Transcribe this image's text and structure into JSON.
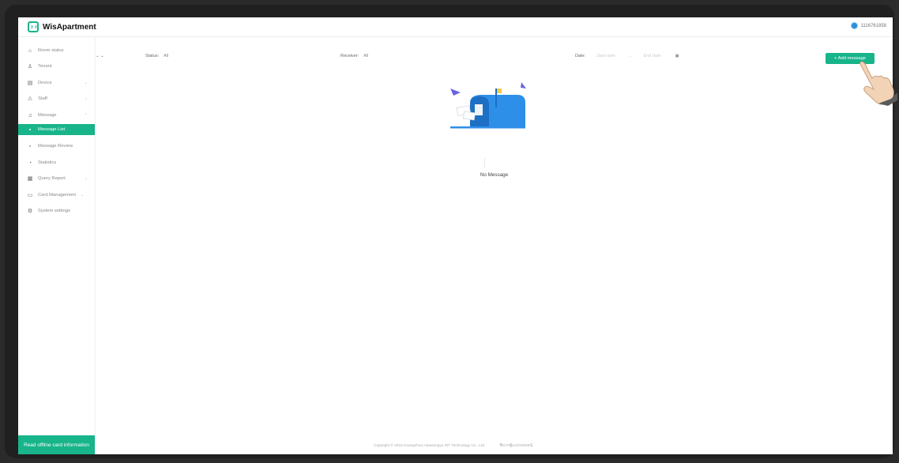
{
  "app": {
    "name": "WisApartment"
  },
  "user": {
    "id": "1116761858"
  },
  "sidebar": {
    "items": [
      {
        "label": "Room status",
        "icon": "home-icon",
        "chevron": false,
        "sub": false,
        "active": false
      },
      {
        "label": "Tenant",
        "icon": "person-icon",
        "chevron": false,
        "sub": false,
        "active": false
      },
      {
        "label": "Device",
        "icon": "device-icon",
        "chevron": true,
        "sub": false,
        "active": false
      },
      {
        "label": "Staff",
        "icon": "staff-icon",
        "chevron": true,
        "sub": false,
        "active": false
      },
      {
        "label": "Message",
        "icon": "bell-icon",
        "chevron": true,
        "sub": false,
        "active": false
      },
      {
        "label": "Message List",
        "icon": "",
        "chevron": false,
        "sub": true,
        "active": true
      },
      {
        "label": "Message Review",
        "icon": "",
        "chevron": false,
        "sub": true,
        "active": false
      },
      {
        "label": "Statistics",
        "icon": "chart-icon",
        "chevron": false,
        "sub": false,
        "active": false
      },
      {
        "label": "Query Report",
        "icon": "report-icon",
        "chevron": true,
        "sub": false,
        "active": false
      },
      {
        "label": "Card Management",
        "icon": "card-icon",
        "chevron": true,
        "sub": false,
        "active": false
      },
      {
        "label": "System settings",
        "icon": "gear-icon",
        "chevron": false,
        "sub": false,
        "active": false
      }
    ],
    "offline_button": "Read offline card information"
  },
  "filters": {
    "status_label": "Status:",
    "status_value": "All",
    "receiver_label": "Receiver:",
    "receiver_value": "All",
    "date_label": "Date:",
    "start_placeholder": "Start date",
    "end_placeholder": "End date"
  },
  "add_button": "+ Add message",
  "empty_text": "No Message",
  "footer": {
    "copyright": "Copyright © 2018 Guangzhou Huaxiangyu IOT Technology Co., Ltd.",
    "icp": "粤ICP备12034559号"
  },
  "colors": {
    "accent": "#18b48a",
    "empty_blue": "#2e8fe8",
    "flag": "#f2c94c"
  }
}
